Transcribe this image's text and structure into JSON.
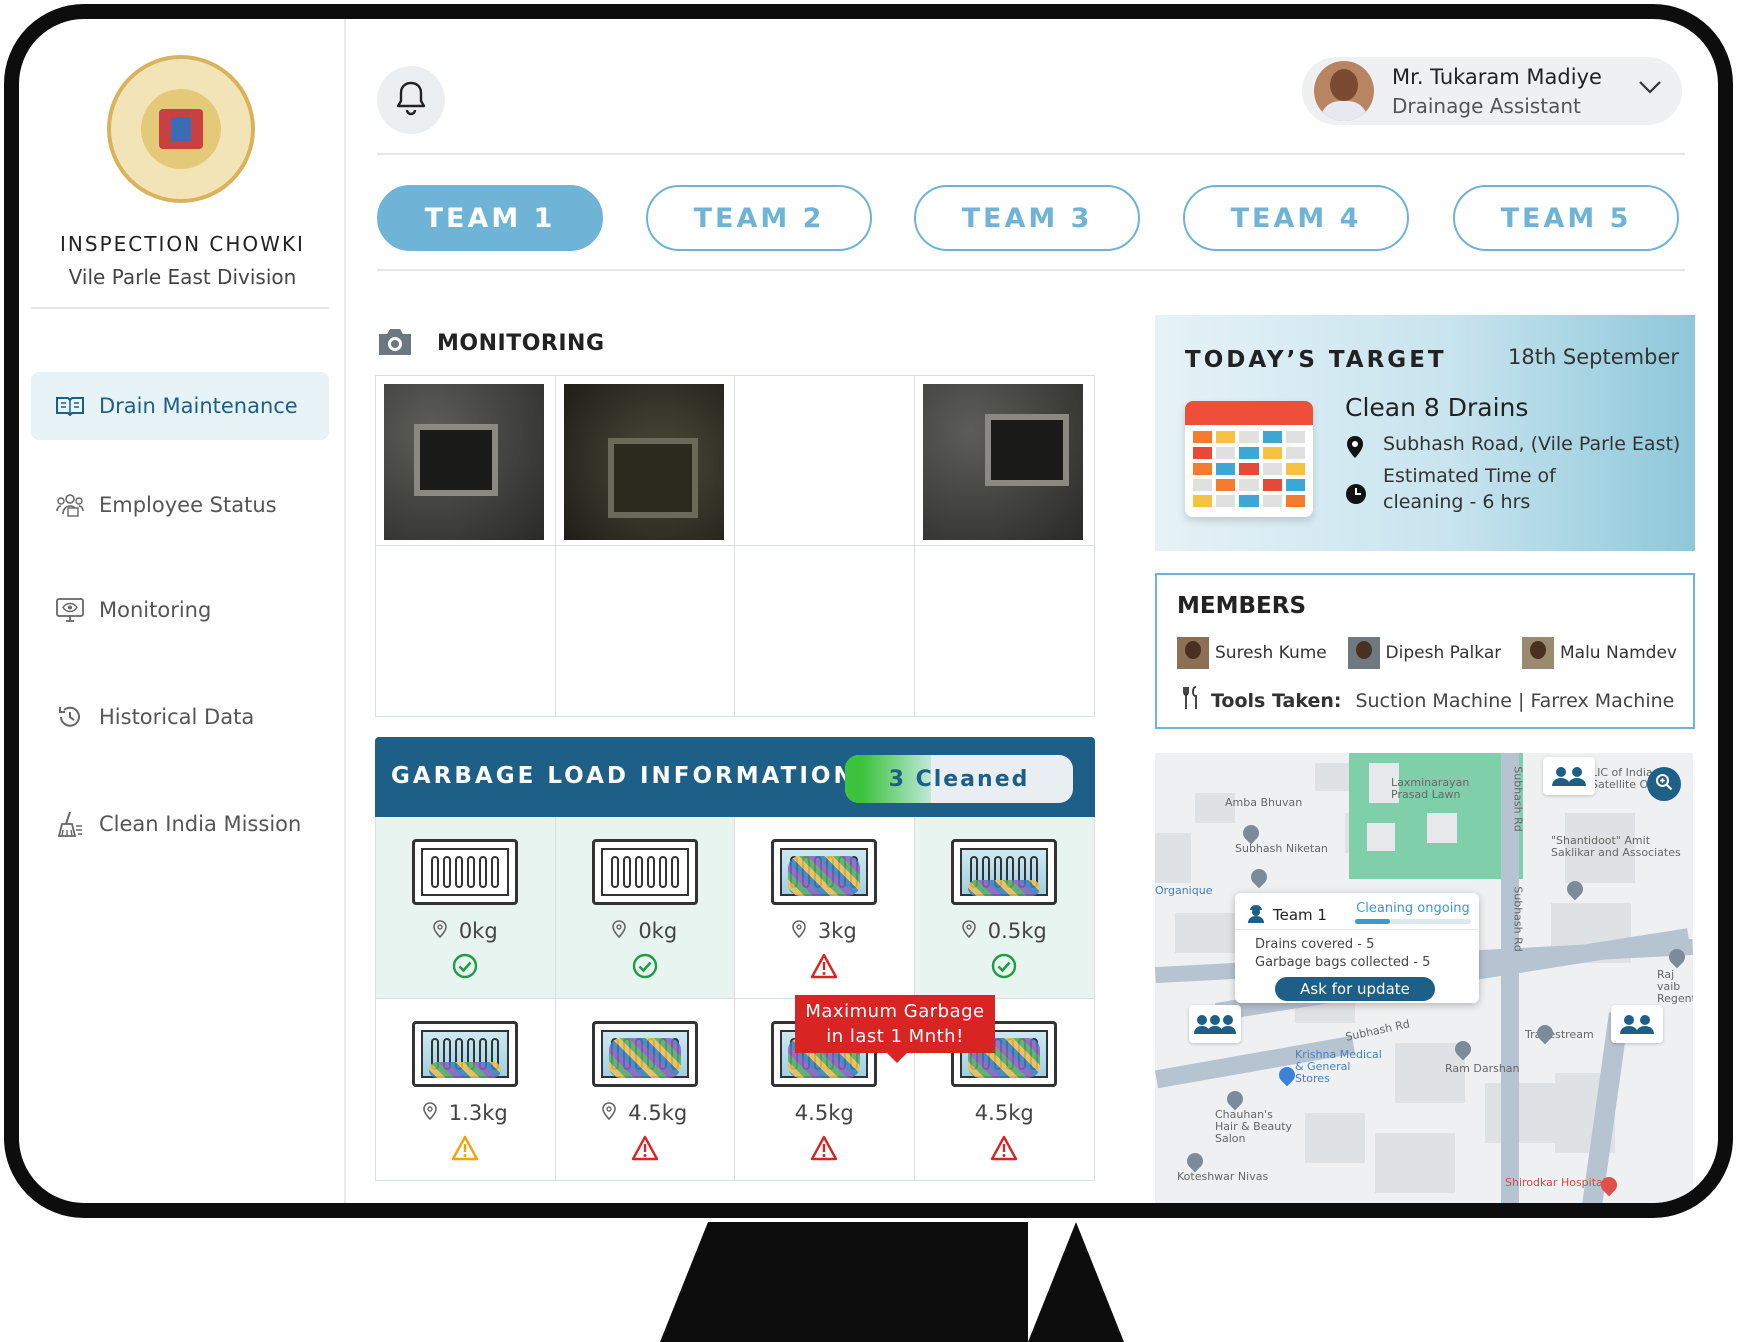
{
  "sidebar": {
    "org_title": "INSPECTION CHOWKI",
    "org_subtitle": "Vile Parle East Division",
    "items": [
      {
        "label": "Drain Maintenance",
        "icon": "book-icon",
        "active": true
      },
      {
        "label": "Employee Status",
        "icon": "team-icon",
        "active": false
      },
      {
        "label": "Monitoring",
        "icon": "monitor-eye-icon",
        "active": false
      },
      {
        "label": "Historical Data",
        "icon": "history-icon",
        "active": false
      },
      {
        "label": "Clean India Mission",
        "icon": "broom-icon",
        "active": false
      }
    ]
  },
  "header": {
    "user_name": "Mr. Tukaram Madiye",
    "user_role": "Drainage Assistant"
  },
  "teams": [
    "TEAM 1",
    "TEAM 2",
    "TEAM 3",
    "TEAM 4",
    "TEAM 5"
  ],
  "monitoring": {
    "title": "MONITORING"
  },
  "garbage": {
    "title": "GARBAGE LOAD INFORMATION",
    "cleaned_label": "3 Cleaned",
    "cleaned_fraction": 0.375,
    "tooltip": "Maximum Garbage in last 1 Mnth!",
    "cells": [
      {
        "weight": "0kg",
        "status": "ok",
        "fill": "empty",
        "pin": true
      },
      {
        "weight": "0kg",
        "status": "ok",
        "fill": "empty",
        "pin": true
      },
      {
        "weight": "3kg",
        "status": "danger",
        "fill": "full",
        "pin": true
      },
      {
        "weight": "0.5kg",
        "status": "ok",
        "fill": "partial",
        "pin": true
      },
      {
        "weight": "1.3kg",
        "status": "warning",
        "fill": "partial",
        "pin": true
      },
      {
        "weight": "4.5kg",
        "status": "danger",
        "fill": "full",
        "pin": true
      },
      {
        "weight": "4.5kg",
        "status": "danger",
        "fill": "full",
        "pin": false
      },
      {
        "weight": "4.5kg",
        "status": "danger",
        "fill": "full",
        "pin": false
      }
    ]
  },
  "target": {
    "title": "TODAY’S TARGET",
    "date": "18th September",
    "main": "Clean 8 Drains",
    "location": "Subhash Road, (Vile Parle East)",
    "time_line1": "Estimated Time of",
    "time_line2": "cleaning - 6 hrs"
  },
  "members": {
    "title": "MEMBERS",
    "list": [
      "Suresh Kume",
      "Dipesh Palkar",
      "Malu Namdev"
    ],
    "tools_label": "Tools Taken:",
    "tools_value": "Suction Machine | Farrex  Machine"
  },
  "map": {
    "labels": {
      "amba": "Amba Bhuvan",
      "niketan": "Subhash Niketan",
      "laxmi": "Laxminarayan Prasad Lawn",
      "lic": "LIC of India, Satellite Off",
      "shantidoot": "\"Shantidoot\" Amit Saklikar and Associates",
      "organique": "Organique",
      "raj": "Raj vaib Regent",
      "tradestream": "Tradestream",
      "ramdarshan": "Ram Darshan",
      "krishna": "Krishna Medical & General Stores",
      "chauhan": "Chauhan's Hair & Beauty Salon",
      "koteshwar": "Koteshwar Nivas",
      "shirodkar": "Shirodkar Hospital",
      "subhash_rd_1": "Subhash Rd",
      "subhash_rd_2": "Subhash Rd",
      "subhash_rd_3": "Subhash Rd"
    },
    "popup": {
      "team": "Team 1",
      "status": "Cleaning ongoing",
      "progress": 0.3,
      "drains": "Drains covered - 5",
      "bags": "Garbage bags collected - 5",
      "button": "Ask for update"
    }
  }
}
